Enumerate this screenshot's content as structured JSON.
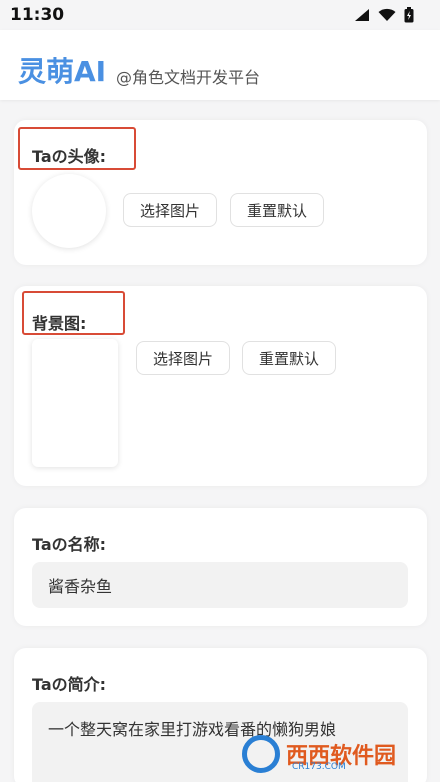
{
  "statusbar": {
    "time": "11:30"
  },
  "header": {
    "brand": "灵萌AI",
    "tagline": "@角色文档开发平台"
  },
  "avatar_section": {
    "title": "Taの头像:",
    "select_label": "选择图片",
    "reset_label": "重置默认"
  },
  "background_section": {
    "title": "背景图:",
    "select_label": "选择图片",
    "reset_label": "重置默认"
  },
  "name_section": {
    "title": "Taの名称:",
    "value": "酱香杂鱼"
  },
  "intro_section": {
    "title": "Taの简介:",
    "value": "一个整天窝在家里打游戏看番的懒狗男娘"
  },
  "watermark": {
    "text": "西西软件园",
    "sub": "CR173.COM"
  },
  "colors": {
    "brand": "#4a90e2",
    "highlight": "#d84b36"
  }
}
